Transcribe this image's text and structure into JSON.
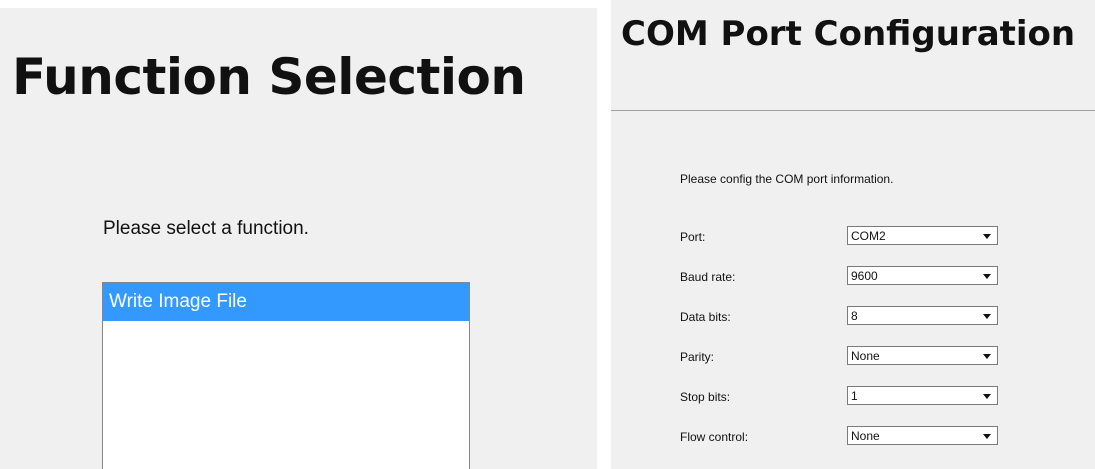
{
  "function_selection": {
    "title": "Function Selection",
    "prompt": "Please select a function.",
    "functions": [
      {
        "label": "Write Image File",
        "selected": true
      }
    ]
  },
  "com_config": {
    "title": "COM Port Configuration",
    "prompt": "Please config the COM port information.",
    "fields": [
      {
        "label": "Port:",
        "value": "COM2"
      },
      {
        "label": "Baud rate:",
        "value": "9600"
      },
      {
        "label": "Data bits:",
        "value": "8"
      },
      {
        "label": "Parity:",
        "value": "None"
      },
      {
        "label": "Stop bits:",
        "value": "1"
      },
      {
        "label": "Flow control:",
        "value": "None"
      }
    ]
  },
  "colors": {
    "selection": "#3399ff",
    "dialog_bg": "#f0f0f0"
  }
}
